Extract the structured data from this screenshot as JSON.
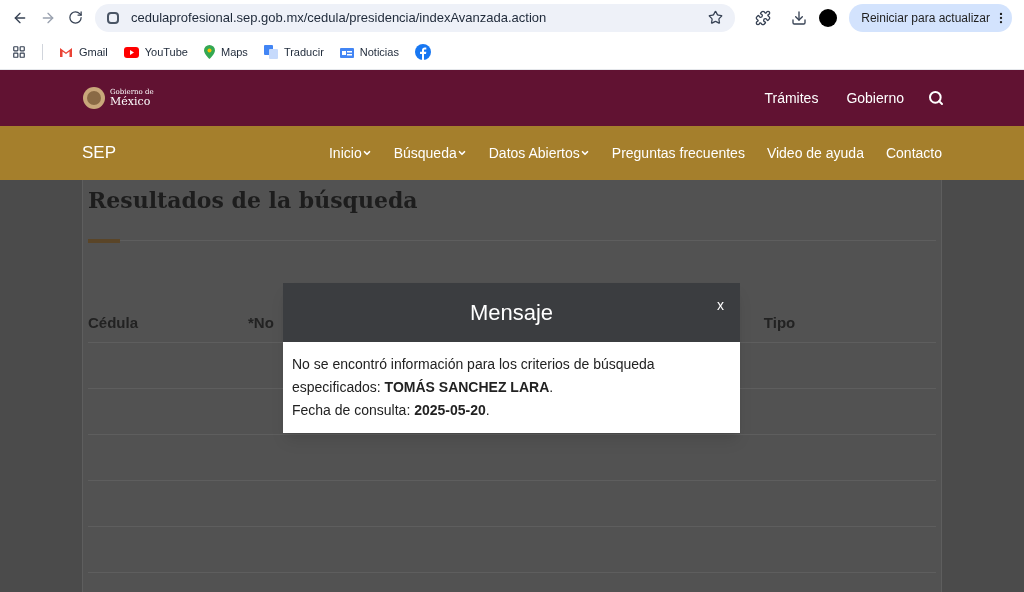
{
  "browser": {
    "url": "cedulaprofesional.sep.gob.mx/cedula/presidencia/indexAvanzada.action",
    "update_button": "Reiniciar para actualizar"
  },
  "bookmarks": [
    {
      "label": "Gmail",
      "kind": "gmail"
    },
    {
      "label": "YouTube",
      "kind": "youtube"
    },
    {
      "label": "Maps",
      "kind": "maps"
    },
    {
      "label": "Traducir",
      "kind": "translate"
    },
    {
      "label": "Noticias",
      "kind": "news"
    },
    {
      "kind": "facebook"
    }
  ],
  "header": {
    "logo_small": "Gobierno de",
    "logo_big": "México",
    "links": [
      "Trámites",
      "Gobierno"
    ]
  },
  "nav": {
    "brand": "SEP",
    "items": [
      {
        "label": "Inicio",
        "dropdown": true
      },
      {
        "label": "Búsqueda",
        "dropdown": true
      },
      {
        "label": "Datos Abiertos",
        "dropdown": true
      },
      {
        "label": "Preguntas frecuentes",
        "dropdown": false
      },
      {
        "label": "Video de ayuda",
        "dropdown": false
      },
      {
        "label": "Contacto",
        "dropdown": false
      }
    ]
  },
  "results": {
    "title": "Resultados de la búsqueda",
    "columns": [
      "Cédula",
      "*No",
      "Tipo"
    ]
  },
  "modal": {
    "title": "Mensaje",
    "close": "x",
    "paragraphs": [
      "No se encontró información para los criterios de búsqueda especificados: **TOMÁS SANCHEZ LARA**.",
      "Fecha de consulta: **2025-05-20**."
    ]
  }
}
